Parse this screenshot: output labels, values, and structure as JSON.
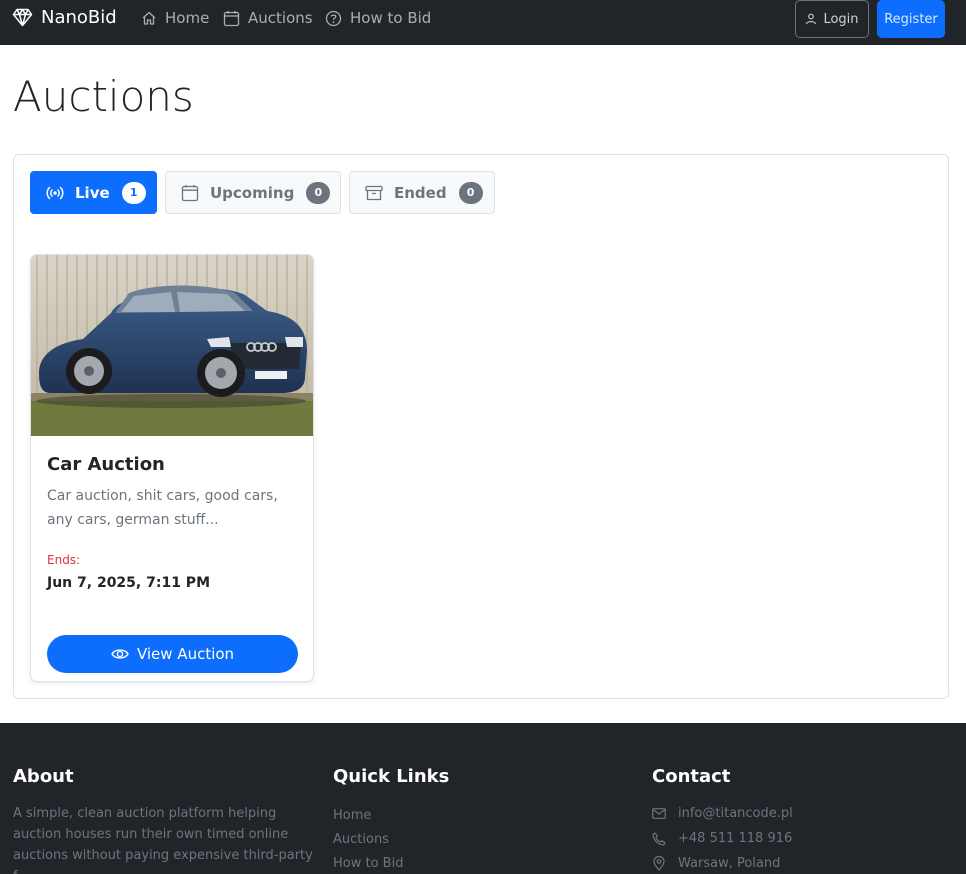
{
  "navbar": {
    "brand": "NanoBid",
    "links": [
      {
        "label": "Home",
        "icon": "house-icon"
      },
      {
        "label": "Auctions",
        "icon": "calendar-icon"
      },
      {
        "label": "How to Bid",
        "icon": "question-circle-icon"
      }
    ],
    "login_label": "Login",
    "register_label": "Register"
  },
  "page": {
    "title": "Auctions"
  },
  "tabs": [
    {
      "label": "Live",
      "count": "1",
      "icon": "broadcast-icon",
      "active": true
    },
    {
      "label": "Upcoming",
      "count": "0",
      "icon": "calendar-icon",
      "active": false
    },
    {
      "label": "Ended",
      "count": "0",
      "icon": "archive-icon",
      "active": false
    }
  ],
  "auctions": [
    {
      "title": "Car Auction",
      "description": "Car auction, shit cars, good cars, any cars, german stuff...",
      "ends_label": "Ends:",
      "ends_date": "Jun 7, 2025, 7:11 PM",
      "button_label": "View Auction",
      "image": "blue-sedan-photo"
    }
  ],
  "footer": {
    "about_heading": "About",
    "about_text": "A simple, clean auction platform helping auction houses run their own timed online auctions without paying expensive third-party f...",
    "links_heading": "Quick Links",
    "links": [
      "Home",
      "Auctions",
      "How to Bid"
    ],
    "contact_heading": "Contact",
    "contact": [
      {
        "text": "info@titancode.pl",
        "icon": "envelope-icon"
      },
      {
        "text": "+48 511 118 916",
        "icon": "phone-icon"
      },
      {
        "text": "Warsaw, Poland",
        "icon": "geo-pin-icon"
      }
    ]
  },
  "colors": {
    "primary": "#0d6efd",
    "dark": "#212529",
    "muted": "#6c757d",
    "danger": "#dc3545"
  }
}
